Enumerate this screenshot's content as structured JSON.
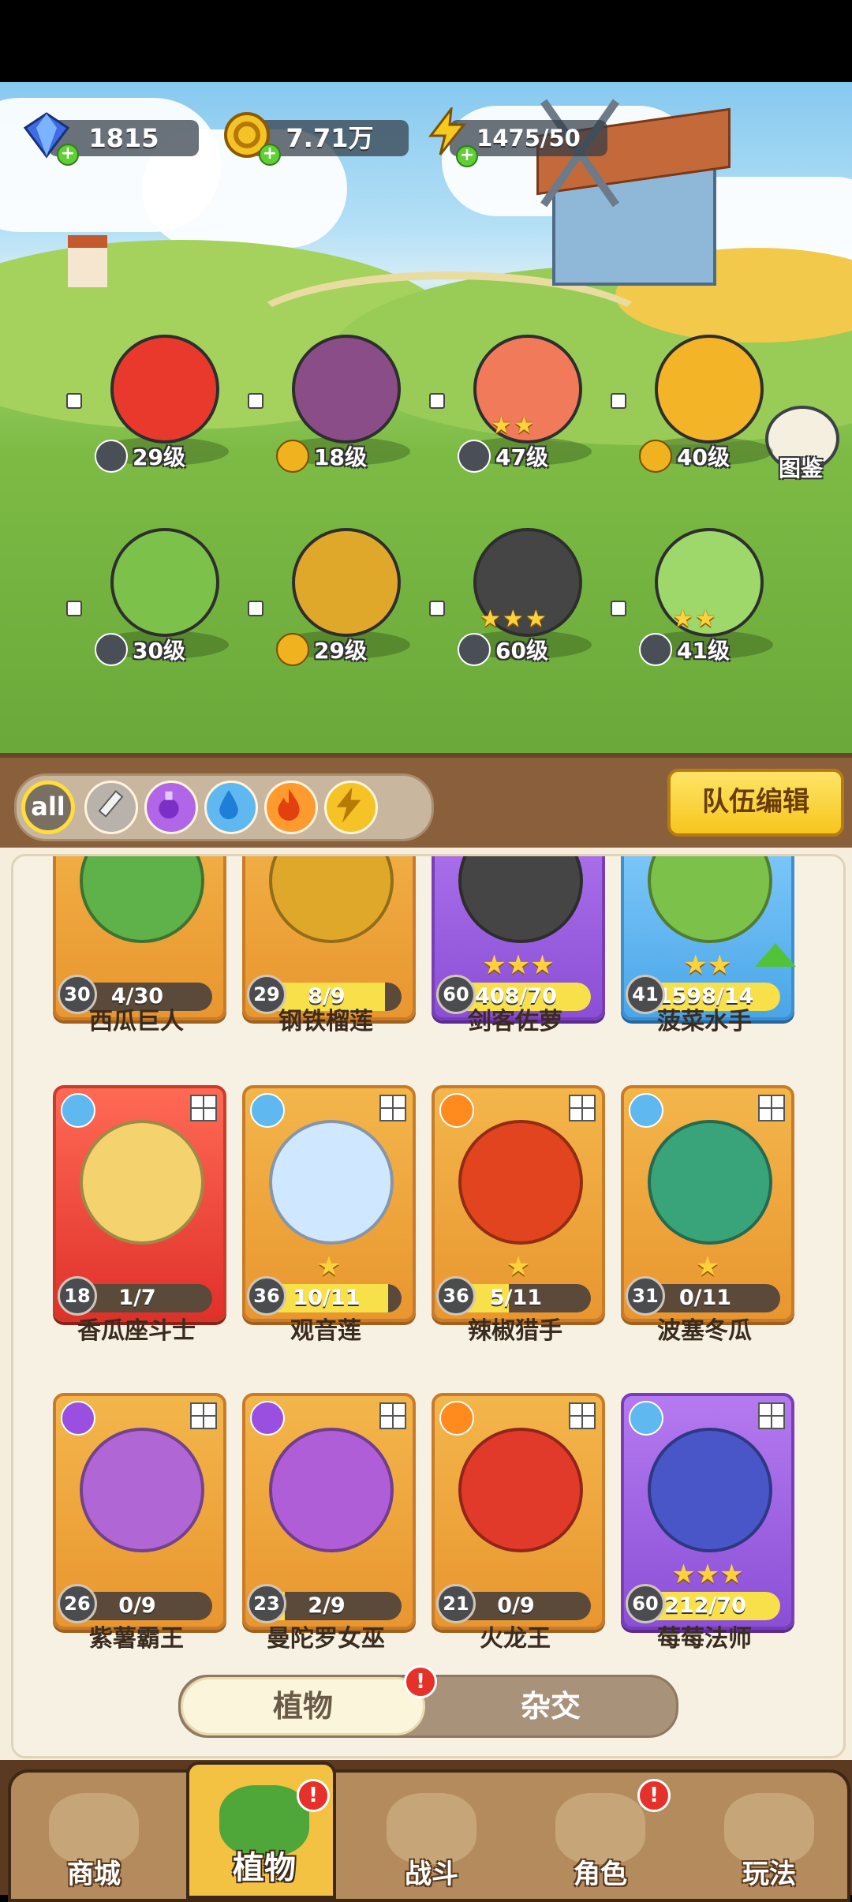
{
  "hud": {
    "gems": "1815",
    "coins": "7.71万",
    "energy": "1475/50"
  },
  "album_label": "图鉴",
  "team": [
    {
      "level": "29级",
      "class": "sword",
      "stars": 0
    },
    {
      "level": "18级",
      "class": "bolt",
      "stars": 0
    },
    {
      "level": "47级",
      "class": "sword",
      "stars": 2
    },
    {
      "level": "40级",
      "class": "bolt",
      "stars": 0
    },
    {
      "level": "30级",
      "class": "sword",
      "stars": 0
    },
    {
      "level": "29级",
      "class": "bolt",
      "stars": 0
    },
    {
      "level": "60级",
      "class": "sword",
      "stars": 3
    },
    {
      "level": "41级",
      "class": "sword",
      "stars": 2
    }
  ],
  "filters": {
    "all_label": "all",
    "items": [
      "all",
      "sword",
      "poison",
      "water",
      "fire",
      "bolt"
    ]
  },
  "team_edit_label": "队伍编辑",
  "cards": [
    {
      "name": "西瓜巨人",
      "level": "30",
      "progress": "4/30",
      "fill": 0.13,
      "stars": 0,
      "theme": "orange"
    },
    {
      "name": "钢铁榴莲",
      "level": "29",
      "progress": "8/9",
      "fill": 0.89,
      "stars": 0,
      "theme": "orange"
    },
    {
      "name": "剑客佐萝",
      "level": "60",
      "progress": "408/70",
      "fill": 1.0,
      "stars": 3,
      "theme": "purple"
    },
    {
      "name": "菠菜水手",
      "level": "41",
      "progress": "1598/14",
      "fill": 1.0,
      "stars": 2,
      "theme": "blue"
    },
    {
      "name": "香瓜座斗士",
      "level": "18",
      "progress": "1/7",
      "fill": 0.14,
      "stars": 0,
      "theme": "red"
    },
    {
      "name": "观音莲",
      "level": "36",
      "progress": "10/11",
      "fill": 0.91,
      "stars": 1,
      "theme": "orange"
    },
    {
      "name": "辣椒猎手",
      "level": "36",
      "progress": "5/11",
      "fill": 0.45,
      "stars": 1,
      "theme": "orange"
    },
    {
      "name": "波塞冬瓜",
      "level": "31",
      "progress": "0/11",
      "fill": 0,
      "stars": 1,
      "theme": "orange"
    },
    {
      "name": "紫薯霸王",
      "level": "26",
      "progress": "0/9",
      "fill": 0,
      "stars": 0,
      "theme": "orange"
    },
    {
      "name": "曼陀罗女巫",
      "level": "23",
      "progress": "2/9",
      "fill": 0.22,
      "stars": 0,
      "theme": "orange"
    },
    {
      "name": "火龙王",
      "level": "21",
      "progress": "0/9",
      "fill": 0,
      "stars": 0,
      "theme": "orange"
    },
    {
      "name": "莓莓法师",
      "level": "60",
      "progress": "212/70",
      "fill": 1.0,
      "stars": 3,
      "theme": "purple"
    }
  ],
  "toggle": {
    "plants": "植物",
    "hybrid": "杂交"
  },
  "nav": [
    {
      "label": "商城"
    },
    {
      "label": "植物"
    },
    {
      "label": "战斗"
    },
    {
      "label": "角色"
    },
    {
      "label": "玩法"
    }
  ]
}
